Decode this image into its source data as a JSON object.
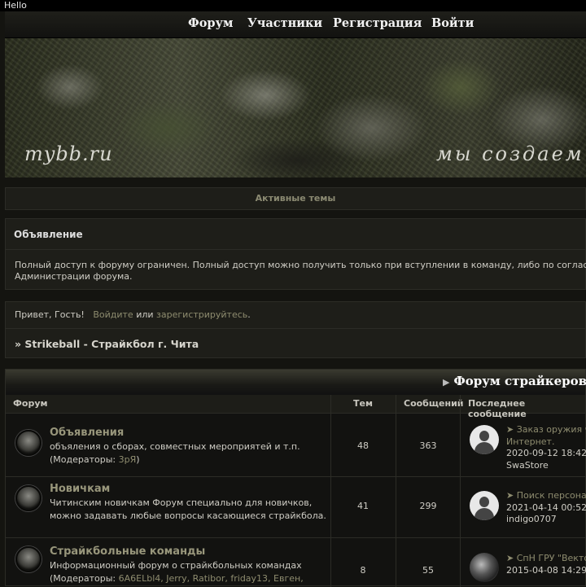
{
  "topbar": {
    "hello": "Hello"
  },
  "nav": {
    "forum": "Форум",
    "members": "Участники",
    "register": "Регистрация",
    "login": "Войти"
  },
  "banner": {
    "logo": "mybb.ru",
    "slogan": "мы создаем общ"
  },
  "active_topics": "Активные темы",
  "announcement": {
    "title": "Объявление",
    "text_line1": "Полный доступ к форуму ограничен. Полный доступ можно получить только при вступлении в команду, либо по соглас",
    "text_line2": "Администрации форума."
  },
  "greeting": {
    "hello": "Привет, Гость!",
    "login": "Войдите",
    "or": "или",
    "register": "зарегистрируйтесь",
    "dot": ".",
    "breadcrumb": "» Strikeball - Страйкбол г. Чита"
  },
  "category": {
    "title": "Форум страйкеров",
    "columns": {
      "forum": "Форум",
      "topics": "Тем",
      "posts": "Сообщений",
      "last": "Последнее сообщение"
    },
    "forums": [
      {
        "name": "Объявления",
        "desc": "объяления о сборах, совместных мероприятей и т.п.",
        "mods_label": "(Модераторы:",
        "mods": "3рЯ",
        "mods_end": ")",
        "topics": "48",
        "posts": "363",
        "last_topic": "➤ Заказ оружия ч",
        "last_topic2": "Интернет.",
        "last_date": "2020-09-12 18:42",
        "last_user": "SwaStore"
      },
      {
        "name": "Новичкам",
        "desc": "Читинским новичкам Форум специально для новичков, можно задавать любые вопросы касающиеся страйкбола.",
        "topics": "41",
        "posts": "299",
        "last_topic": "➤ Поиск персона",
        "last_date": "2021-04-14 00:52",
        "last_user": "indigo0707"
      },
      {
        "name": "Страйкбольные команды",
        "desc": "Информационный форум о страйкбольных командах",
        "mods_label": "(Модераторы:",
        "mods_list": "6A6ELbl4, Jerry, Ratibor, friday13, Евген,",
        "topics": "8",
        "posts": "55",
        "last_topic": "➤ СпН ГРУ \"Векто",
        "last_date": "2015-04-08 14:29"
      }
    ]
  }
}
